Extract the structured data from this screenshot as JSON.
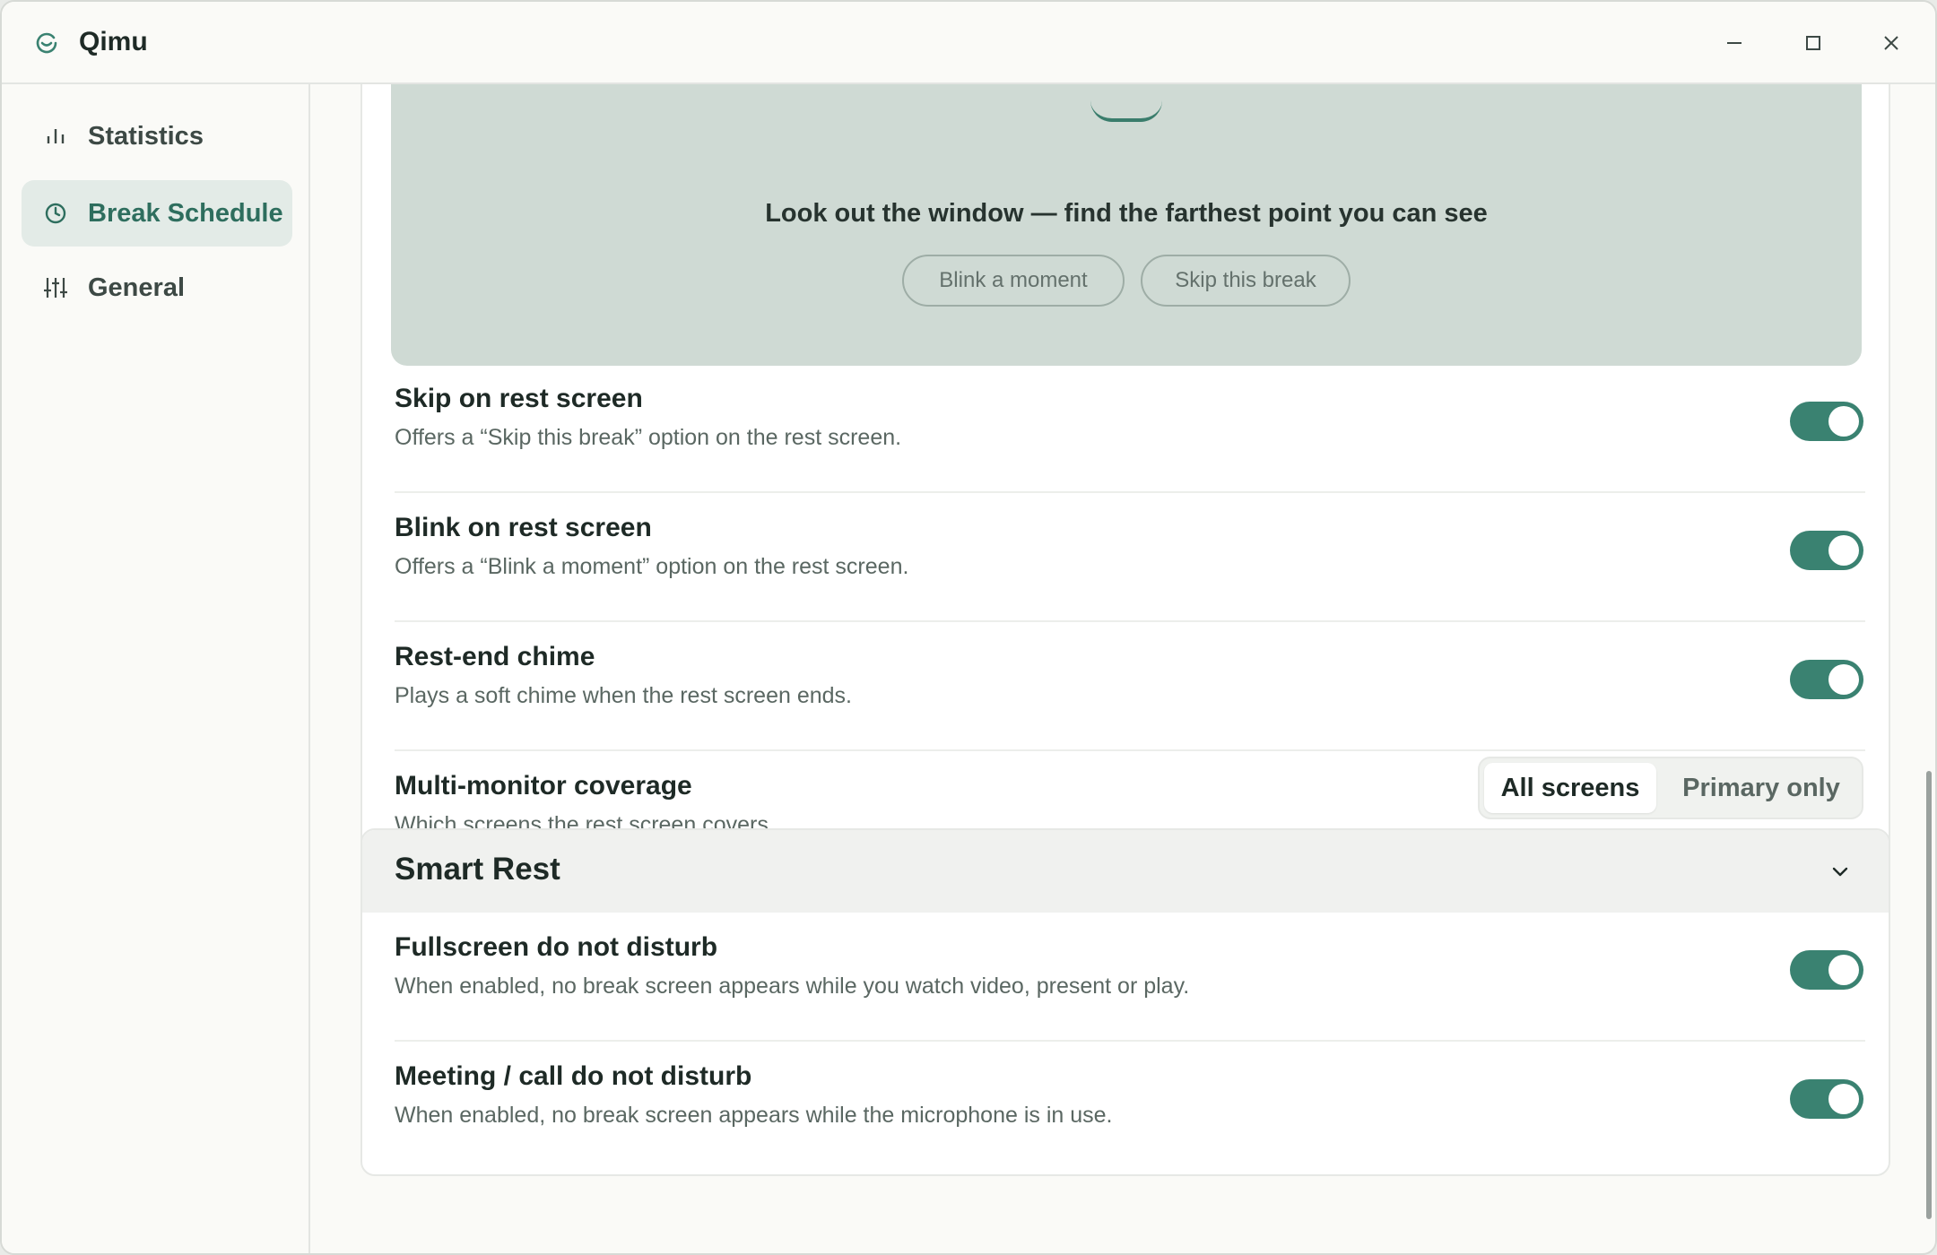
{
  "window": {
    "title": "Qimu",
    "logo_icon": "qimu-logo-icon",
    "controls": {
      "minimize": "minimize-icon",
      "maximize": "maximize-icon",
      "close": "close-icon"
    }
  },
  "sidebar": {
    "items": [
      {
        "label": "Statistics",
        "icon": "bar-chart-icon",
        "active": false
      },
      {
        "label": "Break Schedule",
        "icon": "clock-icon",
        "active": true
      },
      {
        "label": "General",
        "icon": "sliders-icon",
        "active": false
      }
    ]
  },
  "rest_preview": {
    "message": "Look out the window — find the farthest point you can see",
    "blink_button": "Blink a moment",
    "skip_button": "Skip this break"
  },
  "settings": {
    "skip_on_rest": {
      "title": "Skip on rest screen",
      "desc": "Offers a “Skip this break” option on the rest screen.",
      "enabled": true
    },
    "blink_on_rest": {
      "title": "Blink on rest screen",
      "desc": "Offers a “Blink a moment” option on the rest screen.",
      "enabled": true
    },
    "rest_end_chime": {
      "title": "Rest-end chime",
      "desc": "Plays a soft chime when the rest screen ends.",
      "enabled": true
    },
    "multi_monitor": {
      "title": "Multi-monitor coverage",
      "desc": "Which screens the rest screen covers.",
      "options": [
        "All screens",
        "Primary only"
      ],
      "selected": "All screens"
    }
  },
  "smart_rest": {
    "title": "Smart Rest",
    "expanded": true,
    "fullscreen_dnd": {
      "title": "Fullscreen do not disturb",
      "desc": "When enabled, no break screen appears while you watch video, present or play.",
      "enabled": true
    },
    "meeting_dnd": {
      "title": "Meeting / call do not disturb",
      "desc": "When enabled, no break screen appears while the microphone is in use.",
      "enabled": true
    }
  },
  "colors": {
    "accent": "#3a8271",
    "nav_active_bg": "#e3ebe7",
    "preview_bg": "#cfdad4"
  }
}
